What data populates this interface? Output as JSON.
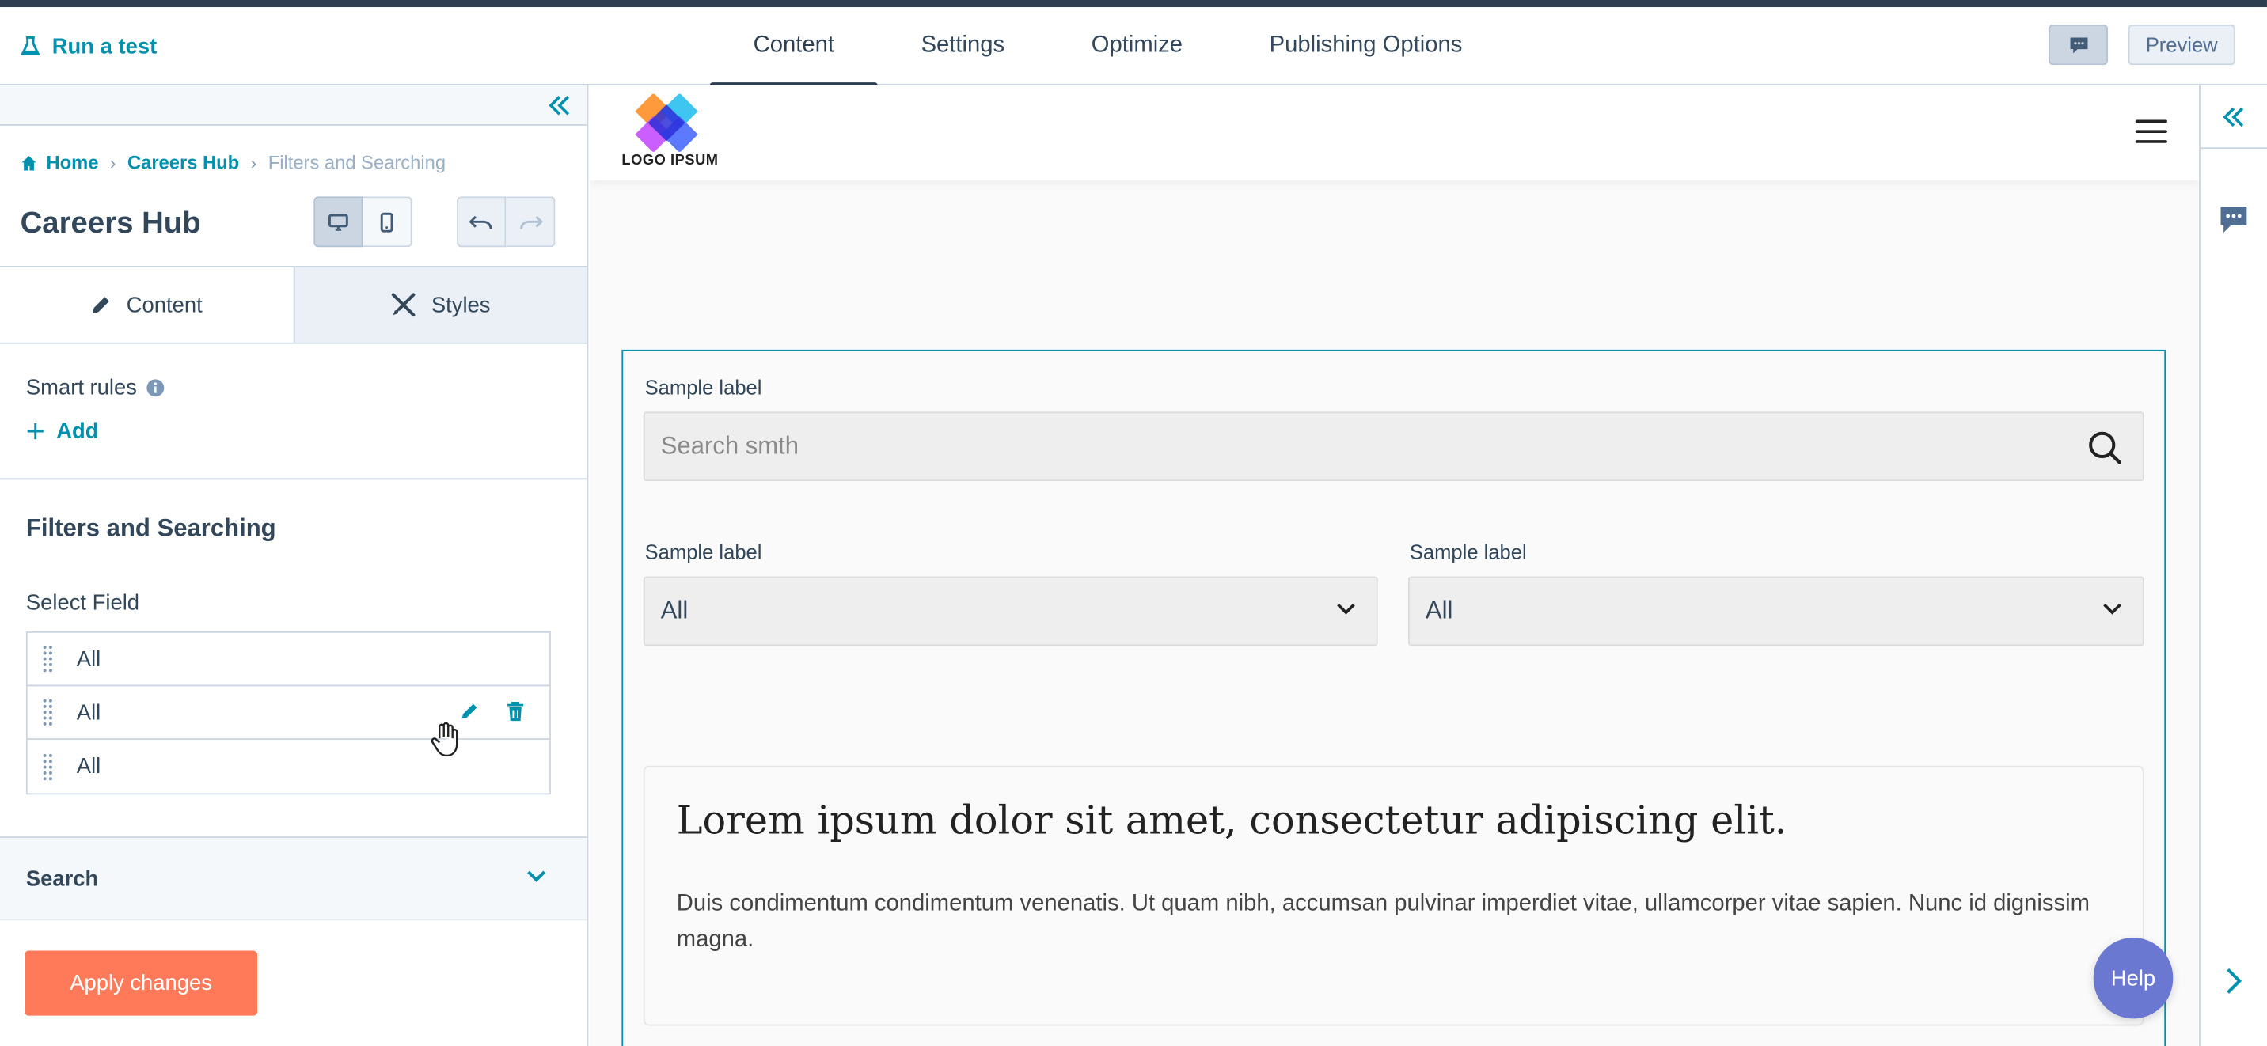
{
  "topbar": {
    "run_test_label": "Run a test",
    "tabs": [
      {
        "label": "Content",
        "active": true
      },
      {
        "label": "Settings",
        "active": false
      },
      {
        "label": "Optimize",
        "active": false
      },
      {
        "label": "Publishing Options",
        "active": false
      }
    ],
    "preview_label": "Preview",
    "chat_icon": "chat-bubble-icon"
  },
  "sidebar": {
    "breadcrumb": {
      "home": "Home",
      "parent": "Careers Hub",
      "current": "Filters and Searching",
      "separator": "›"
    },
    "page_title": "Careers Hub",
    "tabs": [
      {
        "label": "Content",
        "active": true
      },
      {
        "label": "Styles",
        "active": false
      }
    ],
    "smart_rules_label": "Smart rules",
    "add_label": "Add",
    "section_title": "Filters and Searching",
    "select_field_label": "Select Field",
    "fields": [
      {
        "label": "All"
      },
      {
        "label": "All"
      },
      {
        "label": "All"
      }
    ],
    "search_accordion_label": "Search",
    "apply_label": "Apply changes"
  },
  "canvas": {
    "logo_text": "LOGO IPSUM",
    "search_label": "Sample label",
    "search_placeholder": "Search smth",
    "filter1_label": "Sample label",
    "filter1_value": "All",
    "filter2_label": "Sample label",
    "filter2_value": "All",
    "card_title": "Lorem ipsum dolor sit amet, consectetur adipiscing elit.",
    "card_body": "Duis condimentum condimentum venenatis. Ut quam nibh, accumsan pulvinar imperdiet vitae, ullamcorper vitae sapien. Nunc id dignissim magna."
  },
  "help_label": "Help",
  "colors": {
    "accent": "#0091ae",
    "primary_button": "#ff7a59",
    "help_button": "#6a78d1",
    "text": "#33475b",
    "dark_strip": "#2d3e50"
  }
}
